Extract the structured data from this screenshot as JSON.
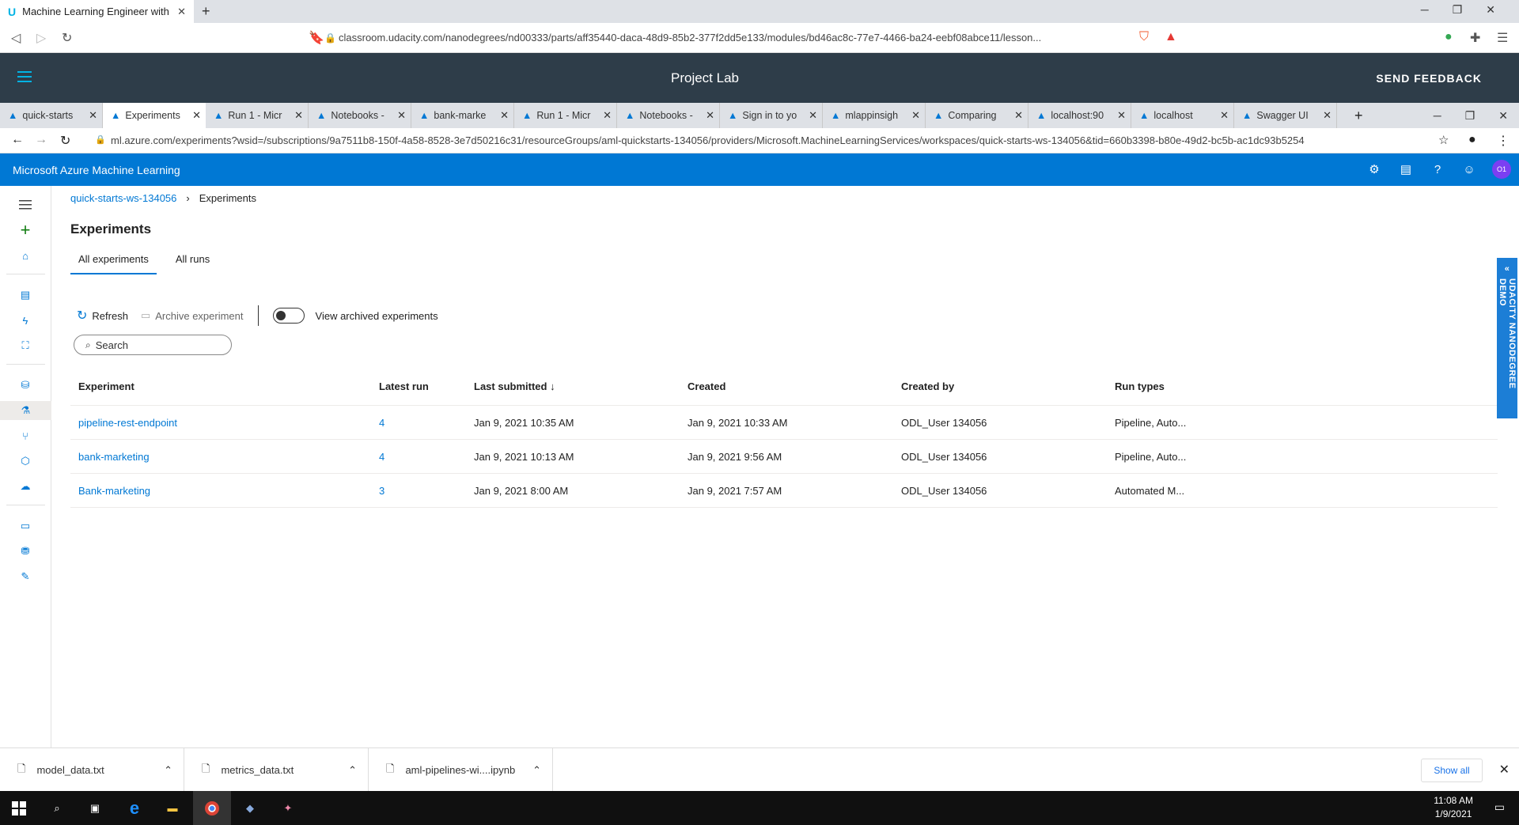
{
  "outer_browser": {
    "tab_title": "Machine Learning Engineer with M",
    "url": "classroom.udacity.com/nanodegrees/nd00333/parts/aff35440-daca-48d9-85b2-377f2dd5e133/modules/bd46ac8c-77e7-4466-ba24-eebf08abce11/lesson..."
  },
  "udacity": {
    "title": "Project Lab",
    "feedback": "SEND FEEDBACK",
    "side_label": "UDACITY NANODEGREE DEMO"
  },
  "inner_browser": {
    "tabs": [
      "quick-starts",
      "Experiments",
      "Run 1 - Micr",
      "Notebooks -",
      "bank-marke",
      "Run 1 - Micr",
      "Notebooks -",
      "Sign in to yo",
      "mlappinsigh",
      "Comparing",
      "localhost:90",
      "localhost",
      "Swagger UI"
    ],
    "url": "ml.azure.com/experiments?wsid=/subscriptions/9a7511b8-150f-4a58-8528-3e7d50216c31/resourceGroups/aml-quickstarts-134056/providers/Microsoft.MachineLearningServices/workspaces/quick-starts-ws-134056&tid=660b3398-b80e-49d2-bc5b-ac1dc93b5254"
  },
  "azure": {
    "title": "Microsoft Azure Machine Learning",
    "avatar": "O1",
    "breadcrumb": {
      "workspace": "quick-starts-ws-134056",
      "current": "Experiments"
    },
    "page_title": "Experiments",
    "tabs": {
      "all_experiments": "All experiments",
      "all_runs": "All runs"
    },
    "toolbar": {
      "refresh": "Refresh",
      "archive": "Archive experiment",
      "view_archived": "View archived experiments"
    },
    "search_placeholder": "Search",
    "table": {
      "headers": [
        "Experiment",
        "Latest run",
        "Last submitted ↓",
        "Created",
        "Created by",
        "Run types"
      ],
      "rows": [
        [
          "pipeline-rest-endpoint",
          "4",
          "Jan 9, 2021 10:35 AM",
          "Jan 9, 2021 10:33 AM",
          "ODL_User 134056",
          "Pipeline, Auto..."
        ],
        [
          "bank-marketing",
          "4",
          "Jan 9, 2021 10:13 AM",
          "Jan 9, 2021 9:56 AM",
          "ODL_User 134056",
          "Pipeline, Auto..."
        ],
        [
          "Bank-marketing",
          "3",
          "Jan 9, 2021 8:00 AM",
          "Jan 9, 2021 7:57 AM",
          "ODL_User 134056",
          "Automated M..."
        ]
      ]
    }
  },
  "downloads": {
    "files": [
      "model_data.txt",
      "metrics_data.txt",
      "aml-pipelines-wi....ipynb"
    ],
    "show_all": "Show all"
  },
  "taskbar": {
    "time": "11:08 AM",
    "date": "1/9/2021"
  },
  "colors": {
    "azure_blue": "#0078d4",
    "udacity_dark": "#2e3d49"
  }
}
